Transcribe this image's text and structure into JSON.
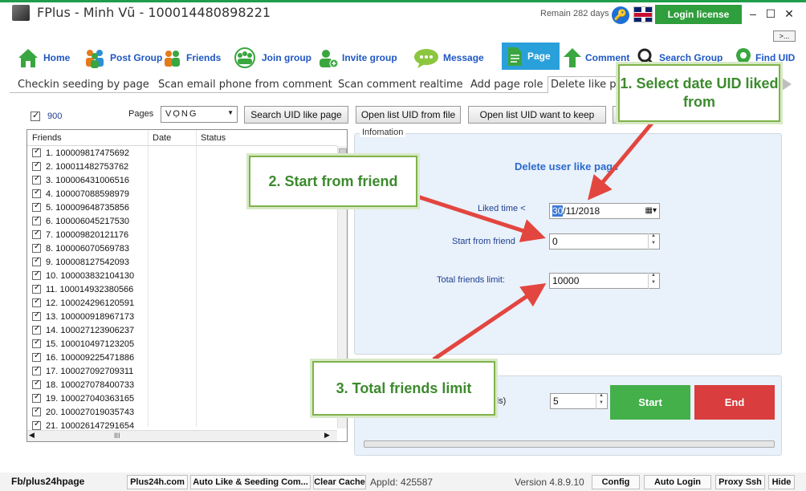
{
  "window": {
    "title": "FPlus - Minh Vũ - 100014480898221",
    "remain": "Remain 282 days",
    "login_license": "Login license",
    "more": ">..."
  },
  "nav": {
    "items": [
      {
        "label": "Home",
        "icon": "home-icon"
      },
      {
        "label": "Post Group",
        "icon": "people-group-icon"
      },
      {
        "label": "Friends",
        "icon": "friends-icon"
      },
      {
        "label": "Join group",
        "icon": "join-group-icon"
      },
      {
        "label": "Invite group",
        "icon": "invite-user-icon"
      },
      {
        "label": "Message",
        "icon": "chat-bubble-icon"
      },
      {
        "label": "Page",
        "icon": "page-document-icon",
        "active": true
      },
      {
        "label": "Comment",
        "icon": "upload-arrow-icon"
      },
      {
        "label": "Search Group",
        "icon": "search-icon"
      },
      {
        "label": "Find UID",
        "icon": "pin-icon"
      }
    ]
  },
  "subtabs": [
    "Checkin seeding by page",
    "Scan email phone from comment",
    "Scan comment realtime",
    "Add page role",
    "Delete like page"
  ],
  "left": {
    "count": "900",
    "pages_label": "Pages",
    "pages_value": "VỌNG",
    "search_button": "Search UID like page",
    "open_file_button": "Open list UID from file",
    "open_keep_button": "Open list UID want to keep",
    "columns": [
      "Friends",
      "Date",
      "Status"
    ],
    "rows": [
      "1. 100009817475692",
      "2. 100011482753762",
      "3. 100006431006516",
      "4. 100007088598979",
      "5. 100009648735856",
      "6. 100006045217530",
      "7. 100009820121176",
      "8. 100006070569783",
      "9. 100008127542093",
      "10. 100003832104130",
      "11. 100014932380566",
      "12. 100024296120591",
      "13. 100000918967173",
      "14. 100027123906237",
      "15. 100010497123205",
      "16. 100009225471886",
      "17. 100027092709311",
      "18. 100027078400733",
      "19. 100027040363165",
      "20. 100027019035743",
      "21. 100026147291654"
    ],
    "hscroll_label": "III"
  },
  "info": {
    "legend": "Infomation",
    "title": "Delete user like page",
    "liked_time_label": "Liked time <",
    "liked_time_day": "30",
    "liked_time_rest": "/11/2018",
    "start_from_label": "Start from friend",
    "start_from_value": "0",
    "total_limit_label": "Total friends limit:",
    "total_limit_value": "10000",
    "delay_suffix": "ds)",
    "delay_value": "5",
    "start_button": "Start",
    "end_button": "End"
  },
  "callouts": {
    "c1": "1. Select date UID liked from",
    "c2": "2. Start from friend",
    "c3": "3. Total friends limit"
  },
  "status": {
    "link": "Fb/plus24hpage",
    "btn_plus24h": "Plus24h.com",
    "btn_auto_like": "Auto Like & Seeding Com...",
    "btn_clear_cache": "Clear Cache",
    "app_id": "AppId: 425587",
    "version": "Version 4.8.9.10",
    "btn_config": "Config",
    "btn_auto_login": "Auto Login",
    "btn_proxy_ssh": "Proxy Ssh",
    "btn_hide": "Hide"
  },
  "colors": {
    "accent_green": "#2f9e3c",
    "nav_blue": "#1f57c3",
    "active_tab": "#2aa0da",
    "start": "#43b04a",
    "end": "#d93d3d",
    "arrow": "#e2463f"
  }
}
